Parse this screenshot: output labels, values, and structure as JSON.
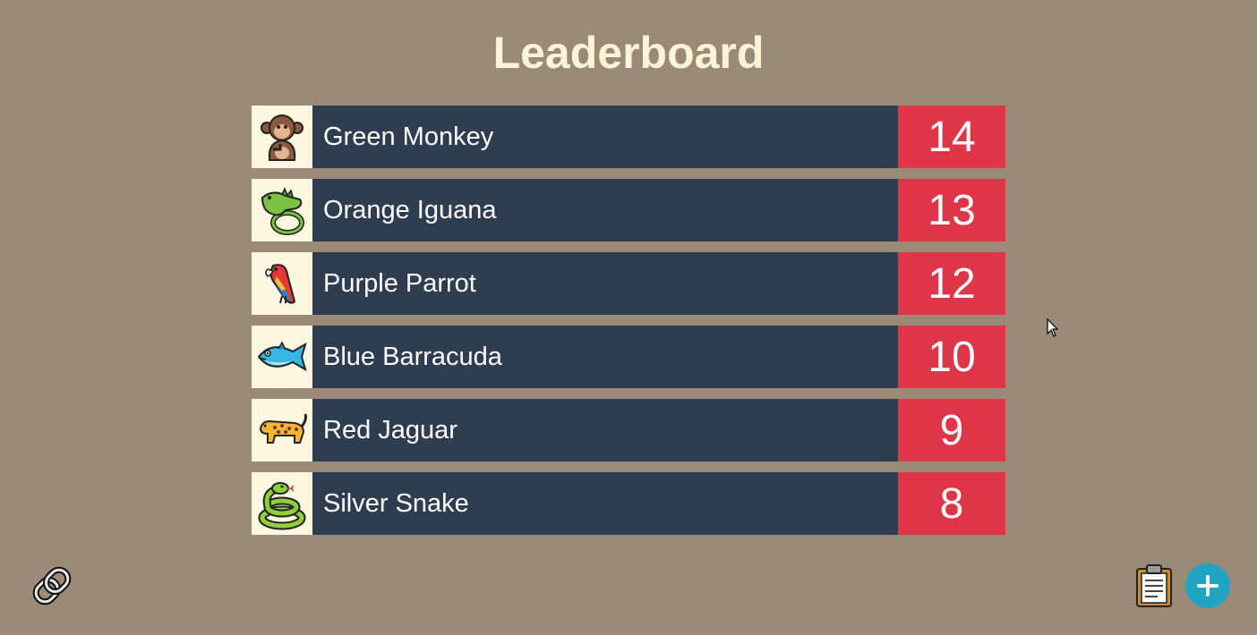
{
  "page": {
    "title": "Leaderboard",
    "colors": {
      "background": "#9b8a77",
      "title": "#fdf4d7",
      "row": "#2f3d50",
      "score": "#de3548",
      "avatar_bg": "#fef8e0",
      "add_button": "#20a4c4"
    }
  },
  "leaderboard": [
    {
      "icon": "monkey-icon",
      "name": "Green Monkey",
      "score": "14"
    },
    {
      "icon": "iguana-icon",
      "name": "Orange Iguana",
      "score": "13"
    },
    {
      "icon": "parrot-icon",
      "name": "Purple Parrot",
      "score": "12"
    },
    {
      "icon": "barracuda-icon",
      "name": "Blue Barracuda",
      "score": "10"
    },
    {
      "icon": "jaguar-icon",
      "name": "Red Jaguar",
      "score": "9"
    },
    {
      "icon": "snake-icon",
      "name": "Silver Snake",
      "score": "8"
    }
  ],
  "footer": {
    "link_icon": "link-icon",
    "clipboard_icon": "clipboard-icon",
    "add_icon": "plus-icon"
  }
}
